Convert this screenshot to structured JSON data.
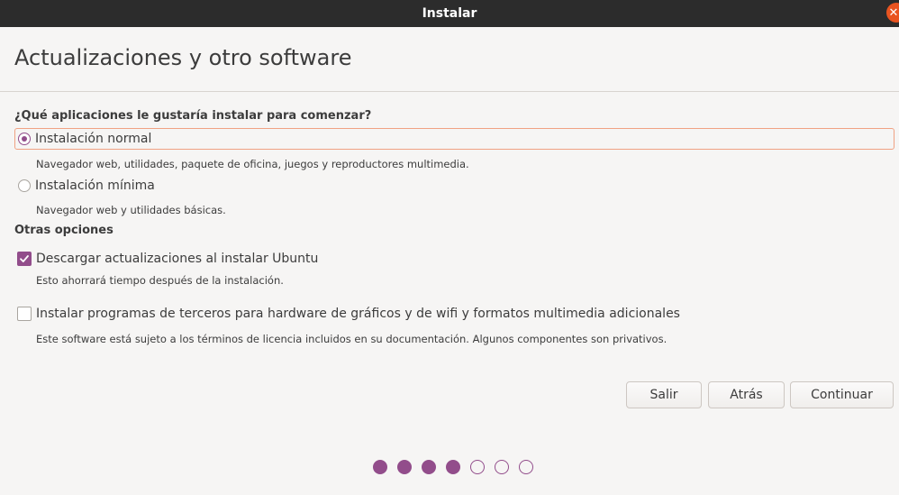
{
  "window": {
    "title": "Instalar",
    "close_glyph": "✕"
  },
  "page": {
    "title": "Actualizaciones y otro software"
  },
  "install_type": {
    "question": "¿Qué aplicaciones le gustaría instalar para comenzar?",
    "options": [
      {
        "label": "Instalación normal",
        "description": "Navegador web, utilidades, paquete de oficina, juegos y reproductores multimedia.",
        "selected": true
      },
      {
        "label": "Instalación mínima",
        "description": "Navegador web y utilidades básicas.",
        "selected": false
      }
    ]
  },
  "other_options": {
    "heading": "Otras opciones",
    "items": [
      {
        "label": "Descargar actualizaciones al instalar Ubuntu",
        "description": "Esto ahorrará tiempo después de la instalación.",
        "checked": true
      },
      {
        "label": "Instalar programas de terceros para hardware de gráficos y de wifi y formatos multimedia adicionales",
        "description": "Este software está sujeto a los términos de licencia incluidos en su documentación. Algunos componentes son privativos.",
        "checked": false
      }
    ]
  },
  "buttons": {
    "quit": "Salir",
    "back": "Atrás",
    "continue": "Continuar"
  },
  "progress": {
    "total_steps": 7,
    "completed_steps": 4
  },
  "colors": {
    "accent": "#924d8b",
    "titlebar": "#2c2c2c",
    "close": "#e95420",
    "focus_border": "#f0a283"
  }
}
